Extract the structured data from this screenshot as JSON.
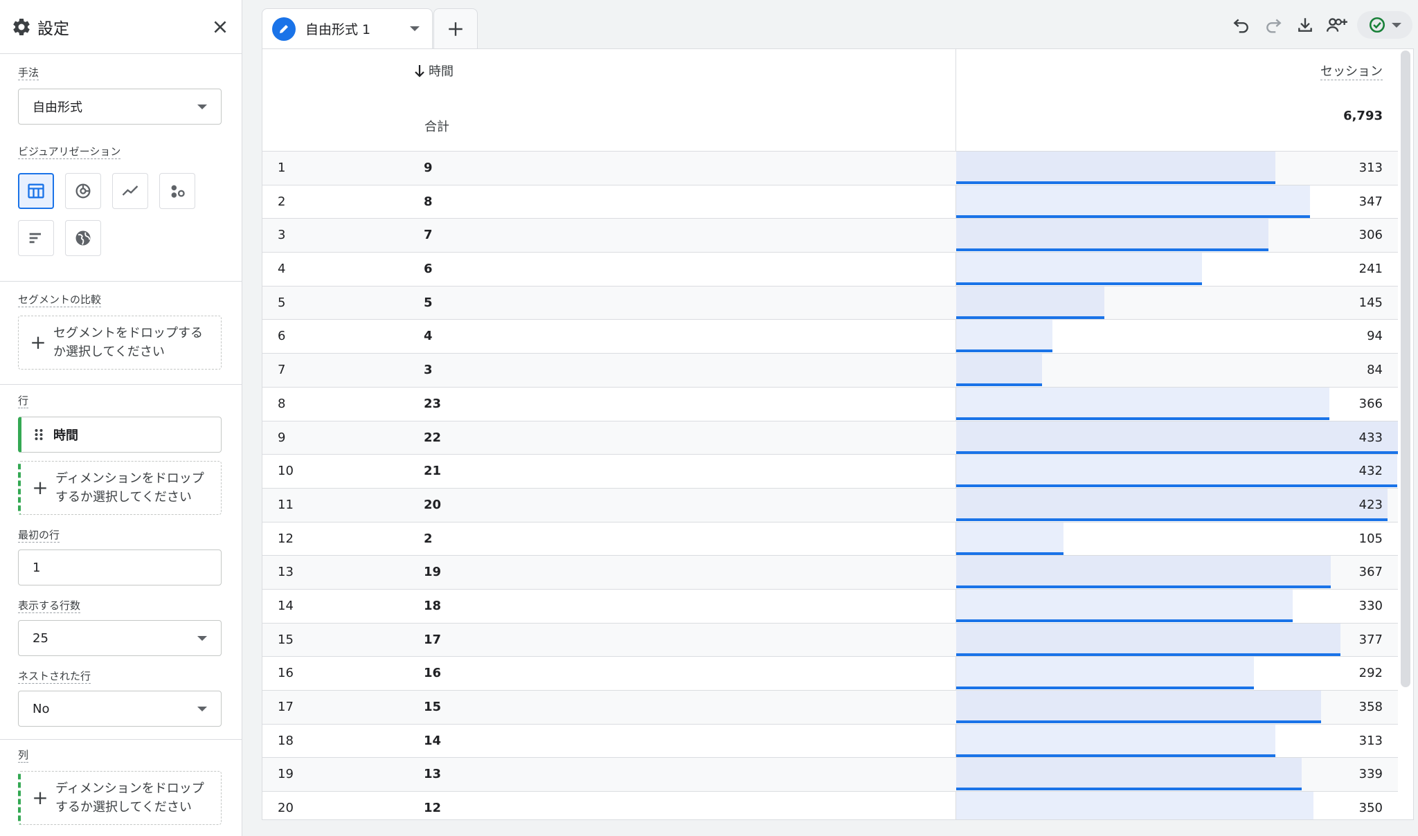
{
  "sidebar": {
    "title": "設定",
    "method_label": "手法",
    "method_value": "自由形式",
    "viz_label": "ビジュアリゼーション",
    "segment_label": "セグメントの比較",
    "segment_drop": [
      "セグメントをドロップする",
      "か選択してください"
    ],
    "rows_label": "行",
    "row_dimension": "時間",
    "dimension_drop": [
      "ディメンションをドロップ",
      "するか選択してください"
    ],
    "first_row_label": "最初の行",
    "first_row_value": "1",
    "show_rows_label": "表示する行数",
    "show_rows_value": "25",
    "nested_label": "ネストされた行",
    "nested_value": "No",
    "columns_label": "列",
    "columns_drop": [
      "ディメンションをドロップ",
      "するか選択してください"
    ]
  },
  "tab": {
    "label": "自由形式 1"
  },
  "colors": {
    "accent": "#1a73e8",
    "green": "#34a853",
    "bar_fill": "#e8eefb"
  },
  "table": {
    "dimension_header": "時間",
    "metric_header": "セッション",
    "total_label": "合計",
    "total_value": "6,793",
    "max_value": 433,
    "rows": [
      {
        "idx": "1",
        "dim": "9",
        "value": 313
      },
      {
        "idx": "2",
        "dim": "8",
        "value": 347
      },
      {
        "idx": "3",
        "dim": "7",
        "value": 306
      },
      {
        "idx": "4",
        "dim": "6",
        "value": 241
      },
      {
        "idx": "5",
        "dim": "5",
        "value": 145
      },
      {
        "idx": "6",
        "dim": "4",
        "value": 94
      },
      {
        "idx": "7",
        "dim": "3",
        "value": 84
      },
      {
        "idx": "8",
        "dim": "23",
        "value": 366
      },
      {
        "idx": "9",
        "dim": "22",
        "value": 433
      },
      {
        "idx": "10",
        "dim": "21",
        "value": 432
      },
      {
        "idx": "11",
        "dim": "20",
        "value": 423
      },
      {
        "idx": "12",
        "dim": "2",
        "value": 105
      },
      {
        "idx": "13",
        "dim": "19",
        "value": 367
      },
      {
        "idx": "14",
        "dim": "18",
        "value": 330
      },
      {
        "idx": "15",
        "dim": "17",
        "value": 377
      },
      {
        "idx": "16",
        "dim": "16",
        "value": 292
      },
      {
        "idx": "17",
        "dim": "15",
        "value": 358
      },
      {
        "idx": "18",
        "dim": "14",
        "value": 313
      },
      {
        "idx": "19",
        "dim": "13",
        "value": 339
      },
      {
        "idx": "20",
        "dim": "12",
        "value": 350
      }
    ]
  }
}
